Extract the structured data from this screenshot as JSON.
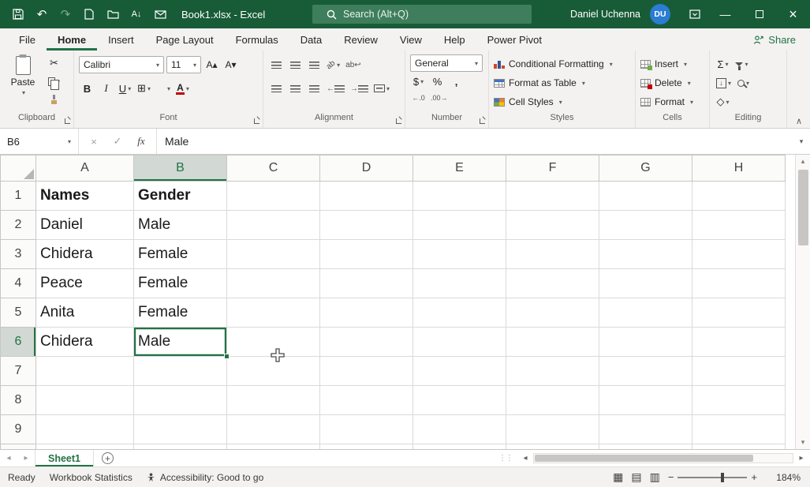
{
  "colors": {
    "excel_green": "#217346",
    "titlebar_green": "#185C37",
    "search_green": "#3E7E5C",
    "avatar_blue": "#2B7CD3",
    "font_color_red": "#C00000",
    "fill_yellow": "#FFC000",
    "ribbon_bg": "#F3F2F1",
    "selected_header_bg": "#D2D8D3"
  },
  "title_bar": {
    "document_title": "Book1.xlsx  -  Excel",
    "search_text": "Search (Alt+Q)",
    "user_name": "Daniel Uchenna",
    "user_initials": "DU"
  },
  "ribbon_tabs": [
    {
      "label": "File",
      "active": false
    },
    {
      "label": "Home",
      "active": true
    },
    {
      "label": "Insert",
      "active": false
    },
    {
      "label": "Page Layout",
      "active": false
    },
    {
      "label": "Formulas",
      "active": false
    },
    {
      "label": "Data",
      "active": false
    },
    {
      "label": "Review",
      "active": false
    },
    {
      "label": "View",
      "active": false
    },
    {
      "label": "Help",
      "active": false
    },
    {
      "label": "Power Pivot",
      "active": false
    }
  ],
  "share_label": "Share",
  "ribbon": {
    "paste_label": "Paste",
    "font_name": "Calibri",
    "font_size": "11",
    "number_format": "General",
    "conditional_formatting": "Conditional Formatting",
    "format_as_table": "Format as Table",
    "cell_styles": "Cell Styles",
    "insert": "Insert",
    "delete": "Delete",
    "format": "Format",
    "group_labels": [
      "Clipboard",
      "Font",
      "Alignment",
      "Number",
      "Styles",
      "Cells",
      "Editing"
    ]
  },
  "glyphs": {
    "chevron_down": "▾",
    "collapse_ribbon": "∧",
    "undo": "↶",
    "redo": "↷",
    "cut": "✂",
    "bold": "B",
    "italic": "I",
    "underline": "U",
    "borders": "⊞",
    "font_color": "A",
    "grow_font": "A▴",
    "shrink_font": "A▾",
    "orientation": "ab",
    "wrap_text": "ab↩",
    "arrow_left": "←",
    "arrow_right": "→",
    "dollar": "$",
    "percent": "%",
    "comma": ",",
    "increase_decimal": "←.0",
    "decrease_decimal": ".00→",
    "autosum": "Σ",
    "fill_down": "↓",
    "clear": "◇",
    "cancel": "×",
    "enter": "✓",
    "fx": "fx",
    "sort_az": "A↓",
    "minimize": "—",
    "close": "×",
    "add_sheet": "+",
    "nav_left": "◂",
    "nav_right": "▸",
    "scroll_up": "▴",
    "scroll_down": "▾",
    "view_normal": "▦",
    "view_page_layout": "▤",
    "view_page_break": "▥",
    "zoom_out": "−",
    "zoom_in": "+",
    "grip": "⋮⋮"
  },
  "formula_bar": {
    "name_box": "B6",
    "value": "Male"
  },
  "sheet": {
    "column_headers": [
      "A",
      "B",
      "C",
      "D",
      "E",
      "F",
      "G",
      "H"
    ],
    "row_headers": [
      "1",
      "2",
      "3",
      "4",
      "5",
      "6",
      "7",
      "8",
      "9"
    ],
    "selected_cell": {
      "col": "B",
      "row": "6"
    },
    "bold_rows": [
      "1"
    ],
    "cells": {
      "A1": "Names",
      "B1": "Gender",
      "A2": "Daniel",
      "B2": "Male",
      "A3": "Chidera",
      "B3": "Female",
      "A4": "Peace",
      "B4": "Female",
      "A5": "Anita",
      "B5": "Female",
      "A6": "Chidera",
      "B6": "Male"
    }
  },
  "sheet_tabs": {
    "active_tab": "Sheet1"
  },
  "status_bar": {
    "ready": "Ready",
    "workbook_statistics": "Workbook Statistics",
    "accessibility": "Accessibility: Good to go",
    "zoom": "184%"
  }
}
